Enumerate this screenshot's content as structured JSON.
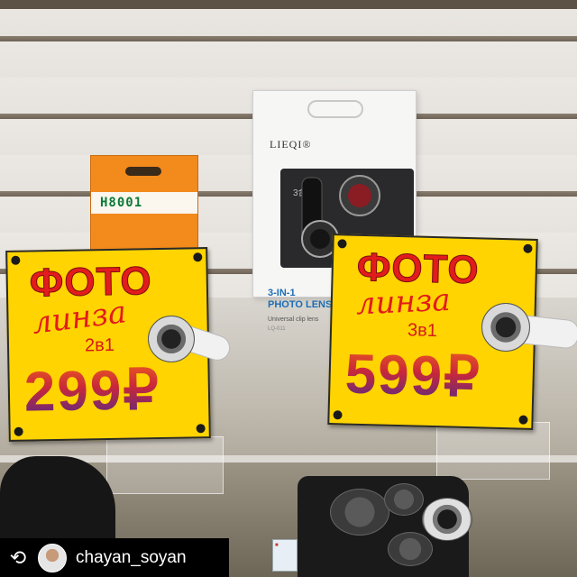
{
  "boxes": {
    "left_brand": "H8001",
    "center_logo": "LIEQI®",
    "center_window_text": "3合",
    "center_title_line1": "3-IN-1",
    "center_title_line2": "PHOTO LENS",
    "center_subtitle": "Universal clip lens",
    "center_code": "LQ-011"
  },
  "tags": {
    "left": {
      "foto": "ФОТО",
      "linza": "линза",
      "count": "2в1",
      "price": "299₽"
    },
    "right": {
      "foto": "ФОТО",
      "linza": "линза",
      "count": "3в1",
      "price": "599₽"
    }
  },
  "repost": {
    "icon": "repost-icon",
    "username": "chayan_soyan"
  },
  "colors": {
    "tag_yellow": "#ffd400",
    "tag_red": "#e21c1c",
    "box_orange": "#f28a1c",
    "lens_box_blue": "#1d6db5"
  }
}
